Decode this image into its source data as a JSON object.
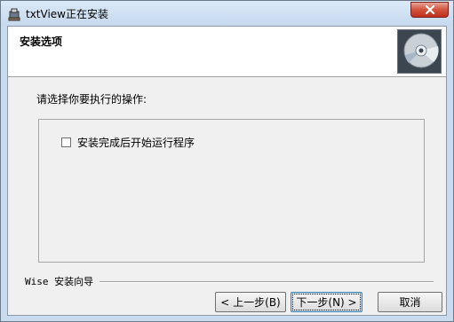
{
  "window": {
    "title": "txtView正在安装",
    "close_icon": "close-icon",
    "app_icon": "installer-icon"
  },
  "header": {
    "title": "安装选项",
    "icon": "cd-disc-icon"
  },
  "main": {
    "prompt": "请选择你要执行的操作:",
    "options": [
      {
        "label": "安装完成后开始运行程序",
        "checked": false
      }
    ]
  },
  "footer": {
    "brand": "Wise 安装向导"
  },
  "buttons": {
    "back": "< 上一步(B)",
    "next": "下一步(N) >",
    "cancel": "取消"
  },
  "colors": {
    "close_button": "#c0301c",
    "title_bar": "#c9dcef"
  }
}
